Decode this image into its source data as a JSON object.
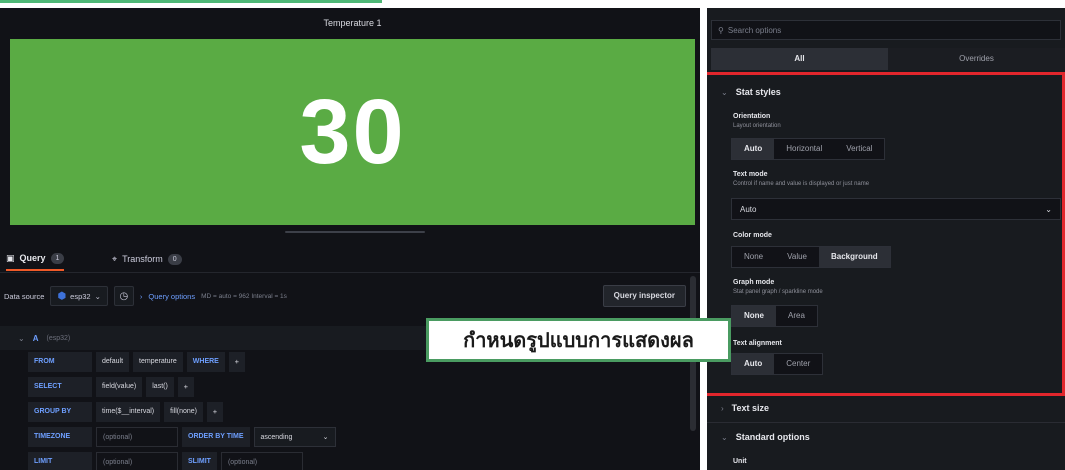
{
  "panel": {
    "title": "Temperature 1",
    "stat_value": "30"
  },
  "editor_tabs": [
    {
      "label": "Query",
      "badge": "1"
    },
    {
      "label": "Transform",
      "badge": "0"
    }
  ],
  "datasource": {
    "label": "Data source",
    "value": "esp32",
    "query_options_label": "Query options",
    "query_options_meta": "MD = auto = 962   Interval = 1s",
    "inspector_label": "Query inspector"
  },
  "query": {
    "letter": "A",
    "ds": "(esp32)",
    "from": {
      "kw": "FROM",
      "parts": [
        "default",
        "temperature"
      ],
      "where": "WHERE"
    },
    "select": {
      "kw": "SELECT",
      "parts": [
        "field(value)",
        "last()"
      ]
    },
    "group_by": {
      "kw": "GROUP BY",
      "parts": [
        "time($__interval)",
        "fill(none)"
      ]
    },
    "timezone": {
      "kw": "TIMEZONE",
      "placeholder": "(optional)",
      "order_kw": "ORDER BY TIME",
      "order_value": "ascending"
    },
    "limit": {
      "kw": "LIMIT",
      "placeholder": "(optional)",
      "slimit_kw": "SLIMIT",
      "slimit_placeholder": "(optional)"
    }
  },
  "options": {
    "search_placeholder": "Search options",
    "tabs": [
      "All",
      "Overrides"
    ],
    "stat_styles": {
      "title": "Stat styles",
      "orientation": {
        "title": "Orientation",
        "desc": "Layout orientation",
        "options": [
          "Auto",
          "Horizontal",
          "Vertical"
        ],
        "selected": "Auto"
      },
      "text_mode": {
        "title": "Text mode",
        "desc": "Control if name and value is displayed or just name",
        "value": "Auto"
      },
      "color_mode": {
        "title": "Color mode",
        "options": [
          "None",
          "Value",
          "Background"
        ],
        "selected": "Background"
      },
      "graph_mode": {
        "title": "Graph mode",
        "desc": "Stat panel graph / sparkline mode",
        "options": [
          "None",
          "Area"
        ],
        "selected": "None"
      },
      "text_alignment": {
        "title": "Text alignment",
        "options": [
          "Auto",
          "Center"
        ],
        "selected": "Auto"
      }
    },
    "text_size": "Text size",
    "standard_options": "Standard options",
    "unit": "Unit"
  },
  "callout": "กำหนดรูปแบบการแสดงผล",
  "colors": {
    "stat_bg": "#5aab44",
    "highlight": "#e1262c",
    "callout_border": "#4a9b61",
    "accent": "#f05a28"
  }
}
